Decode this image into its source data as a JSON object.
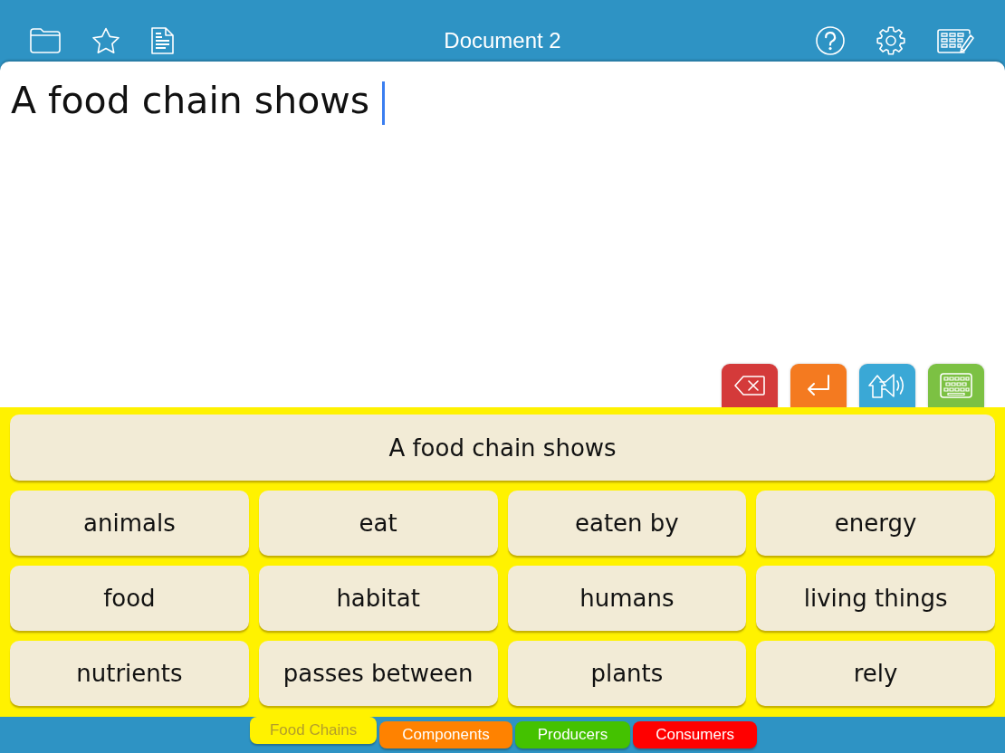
{
  "window": {
    "title": "Document 2"
  },
  "document": {
    "text": "A food chain shows"
  },
  "sentence": "A food chain shows",
  "words": [
    "animals",
    "eat",
    "eaten by",
    "energy",
    "food",
    "habitat",
    "humans",
    "living things",
    "nutrients",
    "passes between",
    "plants",
    "rely"
  ],
  "tabs": [
    {
      "label": "Food Chains",
      "color": "#fff200",
      "selected": true
    },
    {
      "label": "Components",
      "color": "#ff8200",
      "selected": false
    },
    {
      "label": "Producers",
      "color": "#44c200",
      "selected": false
    },
    {
      "label": "Consumers",
      "color": "#ff0000",
      "selected": false
    }
  ]
}
